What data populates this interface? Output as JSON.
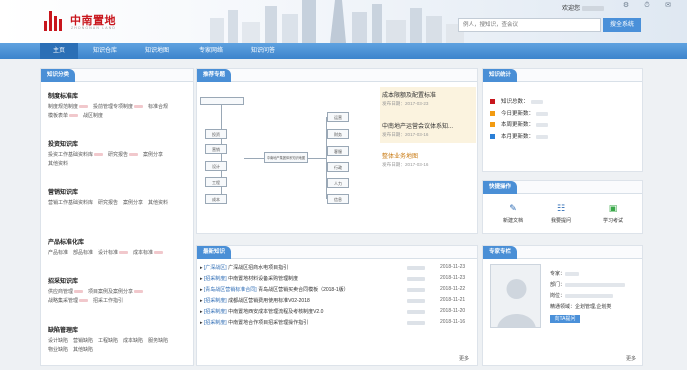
{
  "header": {
    "logo_text": "中南置地",
    "logo_sub": "ZHONGNAN LAND",
    "welcome": "欢迎您",
    "search_placeholder": "例人，搜知识，查会议",
    "search_button": "搜全系统"
  },
  "nav": {
    "items": [
      "主页",
      "知识仓库",
      "知识地图",
      "专家网络",
      "知识问答"
    ]
  },
  "knowledge_category": {
    "title": "知识分类",
    "sections": [
      {
        "title": "制度标准库",
        "links": [
          "制度规范制度",
          "投前管理专项制度",
          "标准合规",
          "模板表单",
          "战区制度"
        ]
      },
      {
        "title": "投资知识库",
        "links": [
          "投资工作基础资料库",
          "研究报告",
          "案例分享",
          "其他资料"
        ]
      },
      {
        "title": "营销知识库",
        "links": [
          "营销工作基础资料库",
          "研究报告",
          "案例分享",
          "其他资料"
        ]
      },
      {
        "title": "产品标准化库",
        "links": [
          "产品标准",
          "部品标准",
          "设计标准",
          "成本标准"
        ]
      },
      {
        "title": "招采知识库",
        "links": [
          "供应商管理",
          "项目案例及案例分享",
          "战略集采管理",
          "招采工作指引"
        ]
      },
      {
        "title": "缺陷管理库",
        "links": [
          "设计缺陷",
          "营销缺陷",
          "工程缺陷",
          "成本缺陷",
          "服务缺陷",
          "物业缺陷",
          "其他缺陷"
        ]
      }
    ]
  },
  "recommend": {
    "title": "推荐专题",
    "diagram": {
      "left": [
        "投资",
        "营销",
        "设计",
        "工程",
        "成本"
      ],
      "center": "中南地产集团体系知识地图",
      "right": [
        "运营",
        "财务",
        "客服",
        "行政",
        "人力",
        "信息"
      ]
    },
    "features": [
      {
        "title": "成本限额及配置标准",
        "date": "发布日期：2017-03-23"
      },
      {
        "title": "中南地产运营会议体系知...",
        "date": "发布日期：2017-03-16"
      },
      {
        "title": "整体业务地图",
        "date": "发布日期：2017-03-16"
      }
    ]
  },
  "latest": {
    "title": "最新知识",
    "more": "更多",
    "rows": [
      {
        "tag": "[广深战区]",
        "text": "广深战区招商水电项目指引",
        "date": "2018-11-23"
      },
      {
        "tag": "[招采制度]",
        "text": "中南置地材料设备采购管理制度",
        "date": "2018-11-23"
      },
      {
        "tag": "[青岛战区营销标准合同]",
        "text": "青岛战区营销买卖合同模板（2018-1版）",
        "date": "2018-11-22"
      },
      {
        "tag": "[招采制度]",
        "text": "成都战区营销费用使用标准V02-2018",
        "date": "2018-11-21"
      },
      {
        "tag": "[招采制度]",
        "text": "中南置地西安成本管理流程及考核制度V2.0",
        "date": "2018-11-20"
      },
      {
        "tag": "[招采制度]",
        "text": "中南置地合作项目招采管理操作指引",
        "date": "2018-11-16"
      }
    ]
  },
  "stats": {
    "title": "知识统计",
    "rows": [
      {
        "label": "知识总数：",
        "color": "#c8161d"
      },
      {
        "label": "今日更新数：",
        "color": "#f29b12"
      },
      {
        "label": "本周更新数：",
        "color": "#f29b12"
      },
      {
        "label": "本月更新数：",
        "color": "#2b7fd6"
      }
    ]
  },
  "quick": {
    "title": "快捷操作",
    "items": [
      {
        "label": "新建文档",
        "icon": "new-doc-icon",
        "color": "#2f6db5"
      },
      {
        "label": "我要提问",
        "icon": "question-icon",
        "color": "#2f6db5"
      },
      {
        "label": "学习考试",
        "icon": "exam-icon",
        "color": "#3aa84a"
      }
    ]
  },
  "expert": {
    "title": "专家专栏",
    "fields": [
      "专家：",
      "部门：",
      "岗位：",
      "精通领域：企划管理,企划类"
    ],
    "ask_button": "向TA提问",
    "more": "更多"
  }
}
